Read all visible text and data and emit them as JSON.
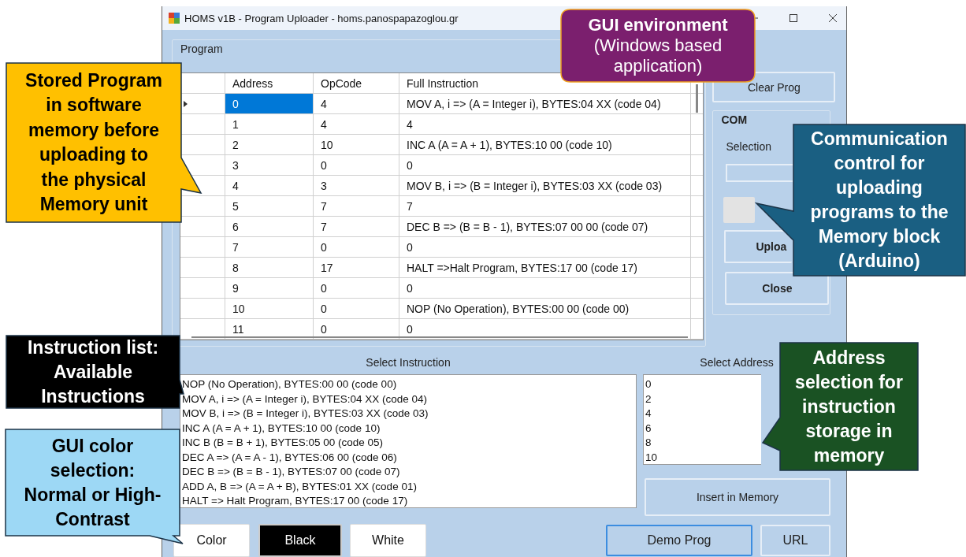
{
  "window": {
    "title": "HOMS v1B - Program Uploader - homs.panospapazoglou.gr"
  },
  "program": {
    "label": "Program",
    "columns": [
      "Address",
      "OpCode",
      "Full Instruction"
    ],
    "rows": [
      {
        "selected": true,
        "cells": [
          "0",
          "4",
          "MOV A, i => (A = Integer i), BYTES:04 XX (code 04)"
        ]
      },
      {
        "selected": false,
        "cells": [
          "1",
          "4",
          "4"
        ]
      },
      {
        "selected": false,
        "cells": [
          "2",
          "10",
          "INC A (A = A + 1), BYTES:10 00 (code 10)"
        ]
      },
      {
        "selected": false,
        "cells": [
          "3",
          "0",
          "0"
        ]
      },
      {
        "selected": false,
        "cells": [
          "4",
          "3",
          "MOV B, i => (B = Integer i), BYTES:03 XX (code 03)"
        ]
      },
      {
        "selected": false,
        "cells": [
          "5",
          "7",
          "7"
        ]
      },
      {
        "selected": false,
        "cells": [
          "6",
          "7",
          "DEC B => (B = B - 1), BYTES:07 00 00 (code 07)"
        ]
      },
      {
        "selected": false,
        "cells": [
          "7",
          "0",
          "0"
        ]
      },
      {
        "selected": false,
        "cells": [
          "8",
          "17",
          "HALT =>Halt Program, BYTES:17 00 (code 17)"
        ]
      },
      {
        "selected": false,
        "cells": [
          "9",
          "0",
          "0"
        ]
      },
      {
        "selected": false,
        "cells": [
          "10",
          "0",
          "NOP (No Operation), BYTES:00 00 (code 00)"
        ]
      },
      {
        "selected": false,
        "cells": [
          "11",
          "0",
          "0"
        ]
      }
    ]
  },
  "clear_button": "Clear Prog",
  "com": {
    "label": "COM",
    "selection_label": "Selection",
    "upload_button": "Uploa",
    "close_button": "Close"
  },
  "select_instruction": {
    "label": "Select Instruction",
    "items": [
      "NOP (No Operation), BYTES:00 00 (code 00)",
      "MOV A, i => (A = Integer i), BYTES:04 XX (code 04)",
      "MOV B, i => (B = Integer i), BYTES:03 XX (code 03)",
      "INC A (A = A + 1), BYTES:10 00 (code 10)",
      "INC B (B = B + 1), BYTES:05 00 (code 05)",
      "DEC A => (A = A - 1), BYTES:06 00 (code 06)",
      "DEC B => (B = B - 1), BYTES:07 00 (code 07)",
      "ADD A, B => (A = A + B), BYTES:01 XX (code 01)",
      "HALT =>  Halt Program, BYTES:17 00 (code 17)"
    ]
  },
  "select_address": {
    "label": "Select Address",
    "items": [
      "0",
      "2",
      "4",
      "6",
      "8",
      "10"
    ]
  },
  "insert_button": "Insert in Memory",
  "color_buttons": [
    {
      "label": "Color",
      "kind": "light"
    },
    {
      "label": "Black",
      "kind": "dark"
    },
    {
      "label": "White",
      "kind": "light"
    }
  ],
  "action_buttons": [
    {
      "label": "Demo Prog",
      "focused": true
    },
    {
      "label": "URL",
      "focused": false
    }
  ],
  "callouts": [
    {
      "text": "Stored Program\nin software\nmemory before\nuploading to\nthe physical\nMemory unit",
      "color": "#ffc000"
    },
    {
      "text": "**GUI environment**\n(Windows based\napplication)",
      "color": "#7b1f6e"
    },
    {
      "text": "Communication\ncontrol for\nuploading\nprograms to the\nMemory block\n(Arduino)",
      "color": "#1a5f82"
    },
    {
      "text": "Instruction list:\nAvailable\nInstructions",
      "color": "#000000"
    },
    {
      "text": "Address\nselection for\ninstruction\nstorage in\nmemory",
      "color": "#1a5223"
    },
    {
      "text": "GUI color\nselection:\nNormal or High-\nContrast",
      "color": "#9dd8f5"
    }
  ]
}
